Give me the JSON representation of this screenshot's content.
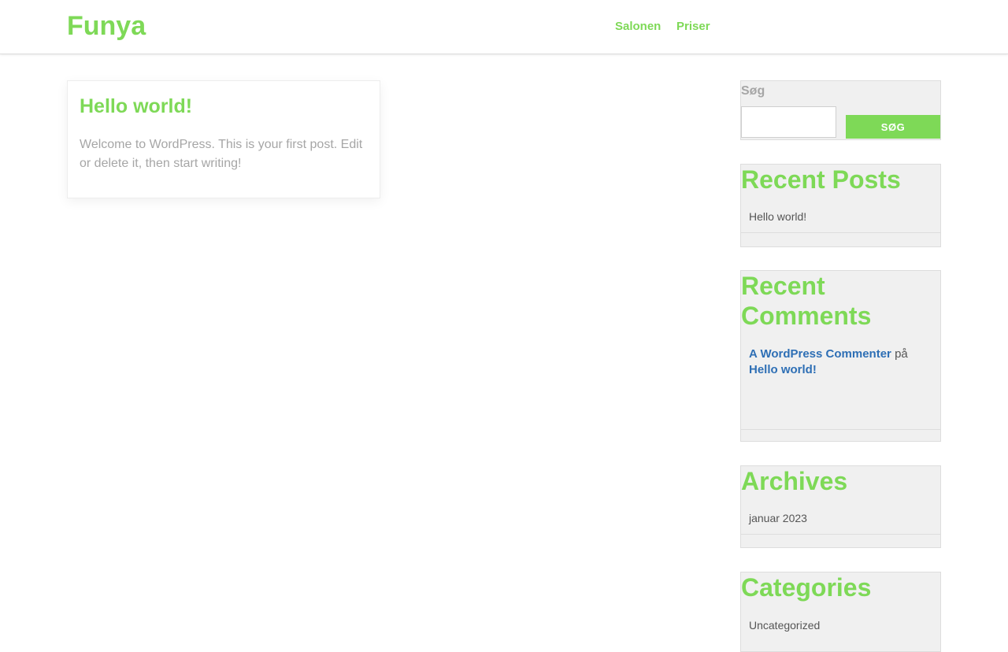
{
  "header": {
    "site_title": "Funya",
    "nav": [
      {
        "label": "Salonen"
      },
      {
        "label": "Priser"
      }
    ]
  },
  "post": {
    "title": "Hello world!",
    "excerpt": "Welcome to WordPress. This is your first post. Edit or delete it, then start writing!"
  },
  "sidebar": {
    "search": {
      "label": "Søg",
      "input_value": "",
      "button_label": "SØG"
    },
    "recent_posts": {
      "title": "Recent Posts",
      "items": [
        {
          "label": "Hello world!"
        }
      ]
    },
    "recent_comments": {
      "title": "Recent Comments",
      "items": [
        {
          "author": "A WordPress Commenter",
          "connector": "på",
          "post": "Hello world!"
        }
      ]
    },
    "archives": {
      "title": "Archives",
      "items": [
        {
          "label": "januar 2023"
        }
      ]
    },
    "categories": {
      "title": "Categories",
      "items": [
        {
          "label": "Uncategorized"
        }
      ]
    }
  },
  "colors": {
    "accent": "#7ed957",
    "link_blue": "#2e6fb5",
    "muted_text": "#a6a6a6",
    "widget_bg": "#f0f0f0"
  }
}
